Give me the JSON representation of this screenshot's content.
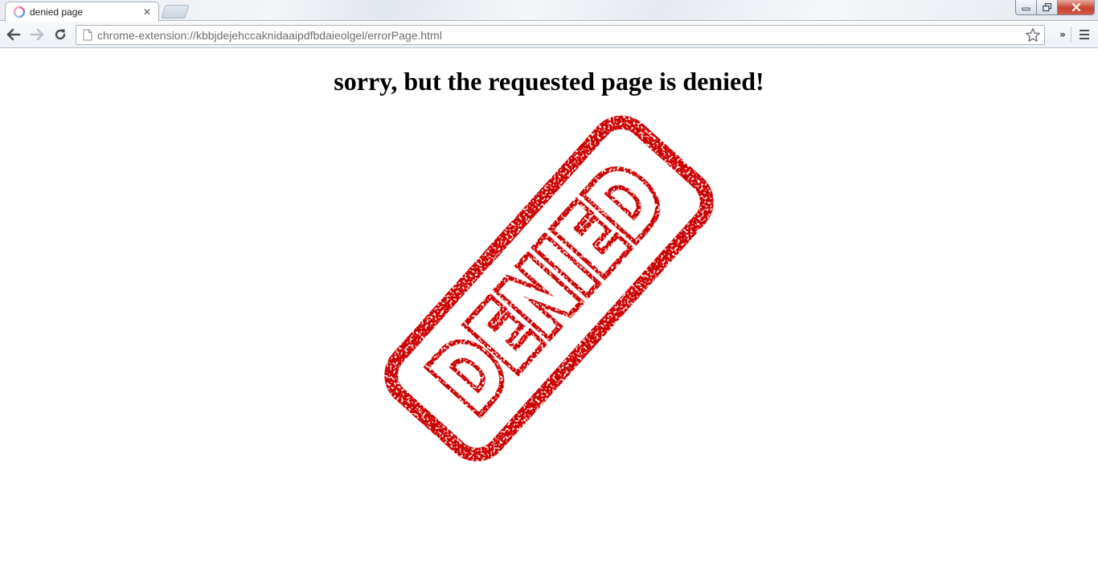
{
  "browser": {
    "tab": {
      "title": "denied page",
      "close_glyph": "✕",
      "favicon": "extension-swirl-icon"
    },
    "address_bar": {
      "url": "chrome-extension://kbbjdejehccaknidaaipdfbdaieolgel/errorPage.html"
    },
    "toolbar": {
      "extensions_overflow": "»"
    }
  },
  "page": {
    "heading": "sorry, but the requested page is denied!",
    "stamp_text": "DENIED",
    "stamp_color": "#cc0000"
  }
}
